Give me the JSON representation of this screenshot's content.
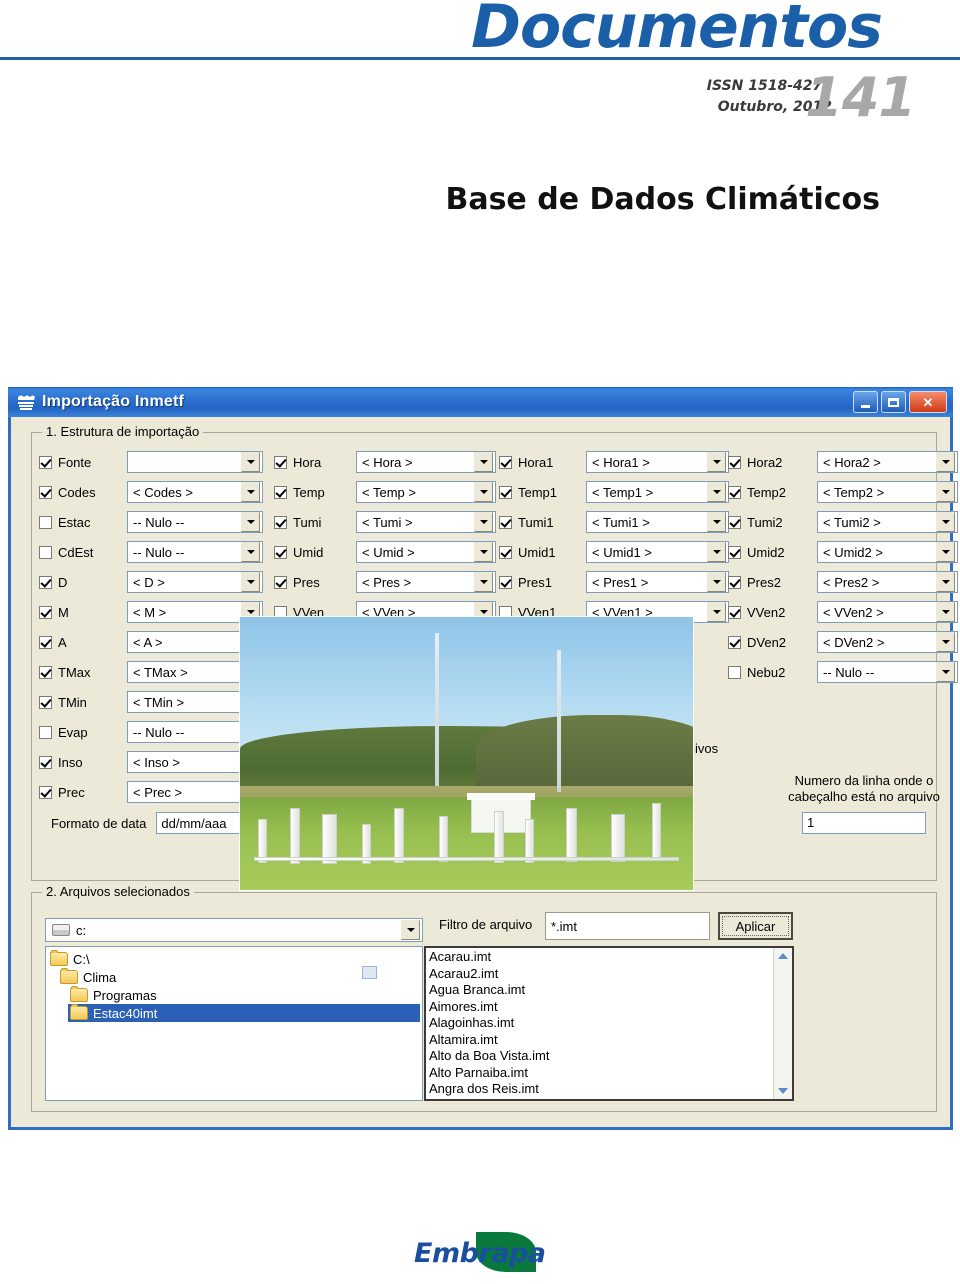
{
  "cover": {
    "title": "Documentos",
    "issn": "ISSN 1518-4277",
    "date": "Outubro, 2012",
    "issue_number": "141",
    "subtitle": "Base de Dados Climáticos",
    "accent_color": "#1a5fa8",
    "issue_color": "#a8a8a8"
  },
  "window": {
    "title": "Importação Inmetf",
    "icon": "app-icon",
    "titlebar_color": "#2d72d0",
    "buttons": {
      "minimize": "minimize-icon",
      "maximize": "maximize-icon",
      "close": "close-icon"
    }
  },
  "group_structure": {
    "legend": "1. Estrutura de importação",
    "columns": [
      {
        "name": "column-1",
        "rows": [
          {
            "label": "Fonte",
            "checked": true,
            "value": ""
          },
          {
            "label": "Codes",
            "checked": true,
            "value": "< Codes >"
          },
          {
            "label": "Estac",
            "checked": false,
            "value": "-- Nulo --"
          },
          {
            "label": "CdEst",
            "checked": false,
            "value": "-- Nulo --"
          },
          {
            "label": "D",
            "checked": true,
            "value": "< D >"
          },
          {
            "label": "M",
            "checked": true,
            "value": "< M >"
          },
          {
            "label": "A",
            "checked": true,
            "value": "< A >"
          },
          {
            "label": "TMax",
            "checked": true,
            "value": "< TMax >"
          },
          {
            "label": "TMin",
            "checked": true,
            "value": "< TMin >"
          },
          {
            "label": "Evap",
            "checked": false,
            "value": "-- Nulo --"
          },
          {
            "label": "Inso",
            "checked": true,
            "value": "< Inso >"
          },
          {
            "label": "Prec",
            "checked": true,
            "value": "< Prec >"
          }
        ]
      },
      {
        "name": "column-2",
        "rows": [
          {
            "label": "Hora",
            "checked": true,
            "value": "< Hora >"
          },
          {
            "label": "Temp",
            "checked": true,
            "value": "< Temp >"
          },
          {
            "label": "Tumi",
            "checked": true,
            "value": "< Tumi >"
          },
          {
            "label": "Umid",
            "checked": true,
            "value": "< Umid >"
          },
          {
            "label": "Pres",
            "checked": true,
            "value": "< Pres >"
          },
          {
            "label": "VVen",
            "checked": false,
            "value": "< VVen >"
          }
        ]
      },
      {
        "name": "column-3",
        "rows": [
          {
            "label": "Hora1",
            "checked": true,
            "value": "< Hora1 >"
          },
          {
            "label": "Temp1",
            "checked": true,
            "value": "< Temp1 >"
          },
          {
            "label": "Tumi1",
            "checked": true,
            "value": "< Tumi1 >"
          },
          {
            "label": "Umid1",
            "checked": true,
            "value": "< Umid1 >"
          },
          {
            "label": "Pres1",
            "checked": true,
            "value": "< Pres1 >"
          },
          {
            "label": "VVen1",
            "checked": false,
            "value": "< VVen1 >"
          }
        ]
      },
      {
        "name": "column-4",
        "rows": [
          {
            "label": "Hora2",
            "checked": true,
            "value": "< Hora2 >"
          },
          {
            "label": "Temp2",
            "checked": true,
            "value": "< Temp2 >"
          },
          {
            "label": "Tumi2",
            "checked": true,
            "value": "< Tumi2 >"
          },
          {
            "label": "Umid2",
            "checked": true,
            "value": "< Umid2 >"
          },
          {
            "label": "Pres2",
            "checked": true,
            "value": "< Pres2 >"
          },
          {
            "label": "VVen2",
            "checked": true,
            "value": "< VVen2 >"
          },
          {
            "label": "DVen2",
            "checked": true,
            "value": "< DVen2 >"
          },
          {
            "label": "Nebu2",
            "checked": false,
            "value": "-- Nulo --"
          }
        ]
      }
    ],
    "date_format": {
      "label": "Formato de data",
      "value": "dd/mm/aaa"
    },
    "arquivos_hint": "ivos",
    "header_line": {
      "label": "Numero da linha onde o cabeçalho está no arquivo",
      "value": "1"
    }
  },
  "group_files": {
    "legend": "2. Arquivos selecionados",
    "drive": {
      "icon": "drive-icon",
      "value": "c:"
    },
    "tree": [
      {
        "label": "C:\\",
        "indent": 0,
        "selected": false
      },
      {
        "label": "Clima",
        "indent": 1,
        "selected": false
      },
      {
        "label": "Programas",
        "indent": 2,
        "selected": false
      },
      {
        "label": "Estac40imt",
        "indent": 2,
        "selected": true
      }
    ],
    "filter_label": "Filtro de arquivo",
    "filter_value": "*.imt",
    "apply_button": "Aplicar",
    "files": [
      "Acarau.imt",
      "Acarau2.imt",
      "Agua Branca.imt",
      "Aimores.imt",
      "Alagoinhas.imt",
      "Altamira.imt",
      "Alto da Boa Vista.imt",
      "Alto Parnaiba.imt",
      "Angra dos Reis.imt"
    ],
    "scroll_up_icon": "chevron-up-icon",
    "scroll_down_icon": "chevron-down-icon"
  },
  "photo": {
    "name": "weather-station-photo",
    "alt": "Estação meteorológica"
  },
  "footer": {
    "logo_text": "Embrapa",
    "logo_blue": "#1a4fa0",
    "logo_green": "#0a7a3c"
  }
}
